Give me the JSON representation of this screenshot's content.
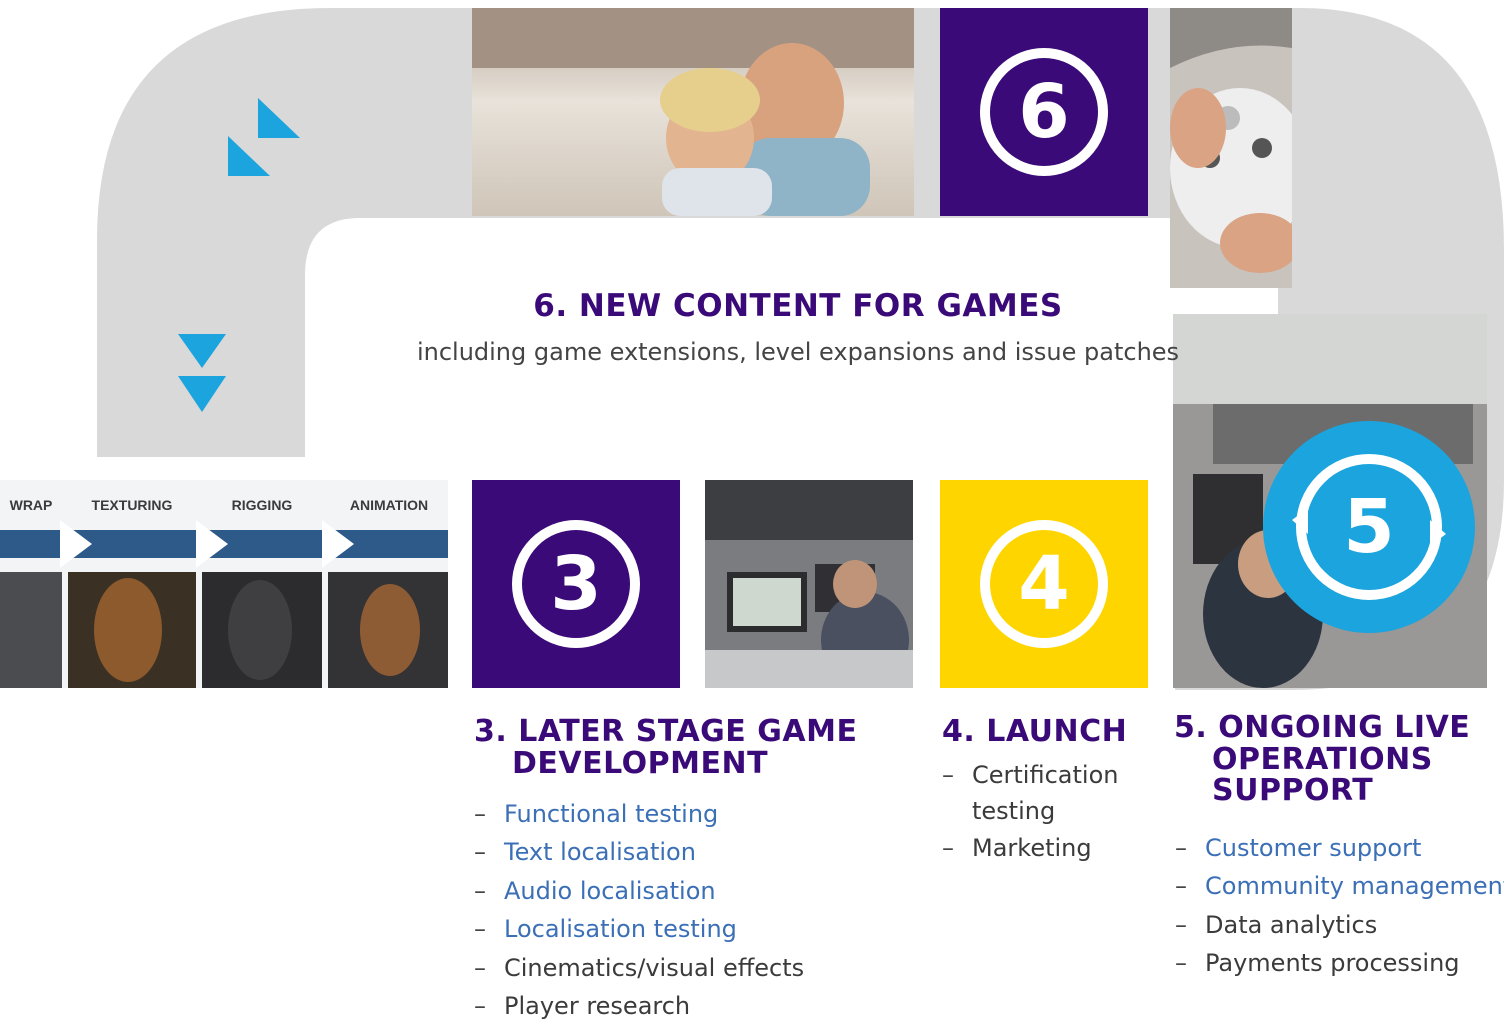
{
  "colors": {
    "purple": "#3a0a78",
    "blue": "#1ba4de",
    "yellow": "#ffd500",
    "road": "#d9d9d9",
    "link": "#3b6fb6"
  },
  "stage6": {
    "number": "6",
    "heading": "6. NEW CONTENT FOR GAMES",
    "subtitle": "including game extensions, level expansions and issue patches"
  },
  "stage3": {
    "number": "3",
    "heading_line1": "3. LATER STAGE GAME",
    "heading_line2": "DEVELOPMENT",
    "items": [
      "Functional testing",
      "Text localisation",
      "Audio localisation",
      "Localisation testing",
      "Cinematics/visual effects",
      "Player research"
    ]
  },
  "stage4": {
    "number": "4",
    "heading": "4. LAUNCH",
    "items": [
      "Certification testing",
      "Marketing"
    ]
  },
  "stage5": {
    "number": "5",
    "heading_line1": "5. ONGOING LIVE",
    "heading_line2": "OPERATIONS",
    "heading_line3": "SUPPORT",
    "items": [
      "Customer support",
      "Community management",
      "Data analytics",
      "Payments processing"
    ]
  },
  "pipeline": {
    "labels": [
      "WRAP",
      "TEXTURING",
      "RIGGING",
      "ANIMATION"
    ]
  },
  "icons": {
    "arrows_diagonal": "double-arrow-up-right-icon",
    "arrows_down": "double-arrow-down-icon"
  }
}
